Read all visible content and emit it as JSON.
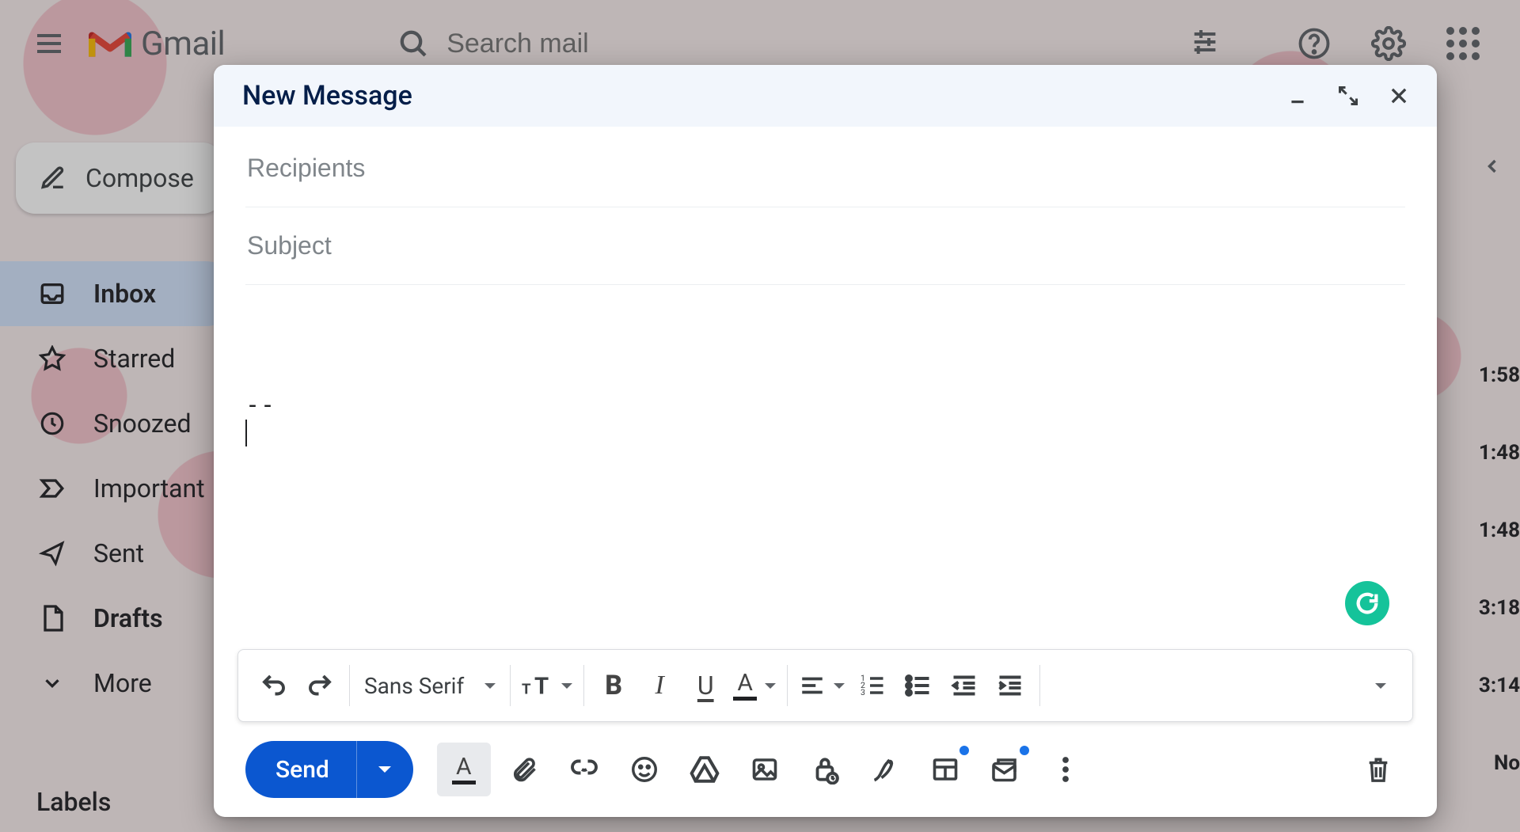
{
  "app_name": "Gmail",
  "search": {
    "placeholder": "Search mail"
  },
  "compose_button": "Compose",
  "sidebar": {
    "items": [
      {
        "label": "Inbox"
      },
      {
        "label": "Starred"
      },
      {
        "label": "Snoozed"
      },
      {
        "label": "Important"
      },
      {
        "label": "Sent"
      },
      {
        "label": "Drafts"
      },
      {
        "label": "More"
      }
    ],
    "labels_heading": "Labels"
  },
  "mail_list_times": [
    "1:58",
    "1:48",
    "1:48",
    "3:18",
    "3:14",
    "No"
  ],
  "compose": {
    "title": "New Message",
    "recipients_placeholder": "Recipients",
    "subject_placeholder": "Subject",
    "body_signature": "--",
    "font_family_label": "Sans Serif",
    "send_label": "Send"
  }
}
